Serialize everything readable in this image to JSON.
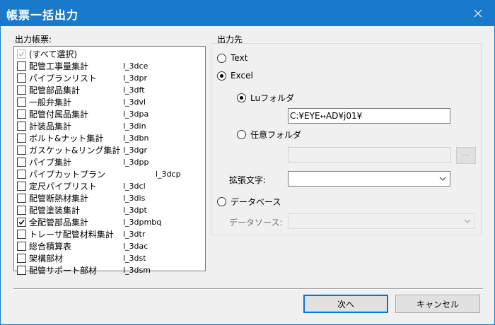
{
  "window": {
    "title": "帳票一括出力"
  },
  "report_list": {
    "label": "出力帳票:",
    "select_all": {
      "label": "(すべて選択)",
      "checked": true,
      "disabled": true
    },
    "items": [
      {
        "label": "配管工事量集計",
        "code": "l_3dce",
        "checked": false
      },
      {
        "label": "パイプランリスト",
        "code": "l_3dpr",
        "checked": false
      },
      {
        "label": "配管部品集計",
        "code": "l_3dft",
        "checked": false
      },
      {
        "label": "一般弁集計",
        "code": "l_3dvl",
        "checked": false
      },
      {
        "label": "配管付属品集計",
        "code": "l_3dpa",
        "checked": false
      },
      {
        "label": "計装品集計",
        "code": "l_3din",
        "checked": false
      },
      {
        "label": "ボルト&ナット集計",
        "code": "l_3dbn",
        "checked": false
      },
      {
        "label": "ガスケット&リング集計",
        "code": "l_3dgr",
        "checked": false
      },
      {
        "label": "パイプ集計",
        "code": "l_3dpp",
        "checked": false
      },
      {
        "label": "パイプカットプラン",
        "code": "l_3dcp",
        "checked": false
      },
      {
        "label": "定尺パイプリスト",
        "code": "l_3dcl",
        "checked": false
      },
      {
        "label": "配管断熱材集計",
        "code": "l_3dis",
        "checked": false
      },
      {
        "label": "配管塗装集計",
        "code": "l_3dpt",
        "checked": false
      },
      {
        "label": "全配管部品集計",
        "code": "l_3dpmbq",
        "checked": true
      },
      {
        "label": "トレーサ配管材料集計",
        "code": "l_3dtr",
        "checked": false
      },
      {
        "label": "総合積算表",
        "code": "l_3dac",
        "checked": false
      },
      {
        "label": "架構部材",
        "code": "l_3dst",
        "checked": false
      },
      {
        "label": "配管サポート部材",
        "code": "l_3dsm",
        "checked": false
      }
    ]
  },
  "output": {
    "label": "出力先",
    "text_option": {
      "label": "Text",
      "selected": false
    },
    "excel_option": {
      "label": "Excel",
      "selected": true
    },
    "lu_folder": {
      "label": "Luフォルダ",
      "selected": true,
      "path": "C:¥EYE",
      "path_mid": "AD¥j01¥"
    },
    "custom_folder": {
      "label": "任意フォルダ",
      "selected": false,
      "path": "",
      "browse": "..."
    },
    "extension": {
      "label": "拡張文字:",
      "value": ""
    },
    "database_option": {
      "label": "データベース",
      "selected": false
    },
    "datasource": {
      "label": "データソース:",
      "value": ""
    }
  },
  "buttons": {
    "next": "次へ",
    "cancel": "キャンセル"
  }
}
